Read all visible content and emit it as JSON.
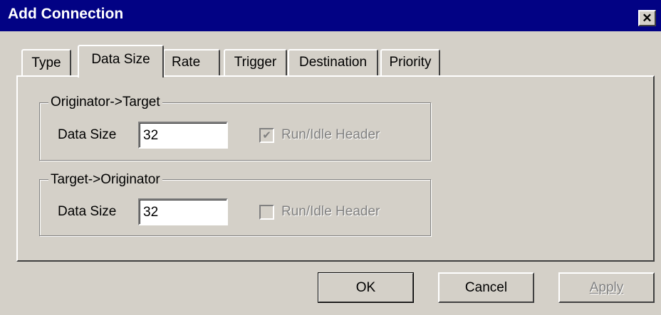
{
  "window": {
    "title": "Add Connection",
    "close_glyph": "✕"
  },
  "tabs": [
    {
      "label": "Type",
      "active": false
    },
    {
      "label": "Data Size",
      "active": true
    },
    {
      "label": "Rate",
      "active": false
    },
    {
      "label": "Trigger",
      "active": false
    },
    {
      "label": "Destination",
      "active": false
    },
    {
      "label": "Priority",
      "active": false
    }
  ],
  "groups": {
    "o2t": {
      "legend": "Originator->Target",
      "data_size_label": "Data Size",
      "data_size_value": "32",
      "run_idle_label": "Run/Idle Header",
      "run_idle_checked": true,
      "run_idle_disabled": true
    },
    "t2o": {
      "legend": "Target->Originator",
      "data_size_label": "Data Size",
      "data_size_value": "32",
      "run_idle_label": "Run/Idle Header",
      "run_idle_checked": false,
      "run_idle_disabled": true
    }
  },
  "buttons": {
    "ok": "OK",
    "cancel": "Cancel",
    "apply": "Apply"
  },
  "colors": {
    "titlebar": "#020284",
    "face": "#d4d0c8",
    "disabled_text": "#808080"
  }
}
